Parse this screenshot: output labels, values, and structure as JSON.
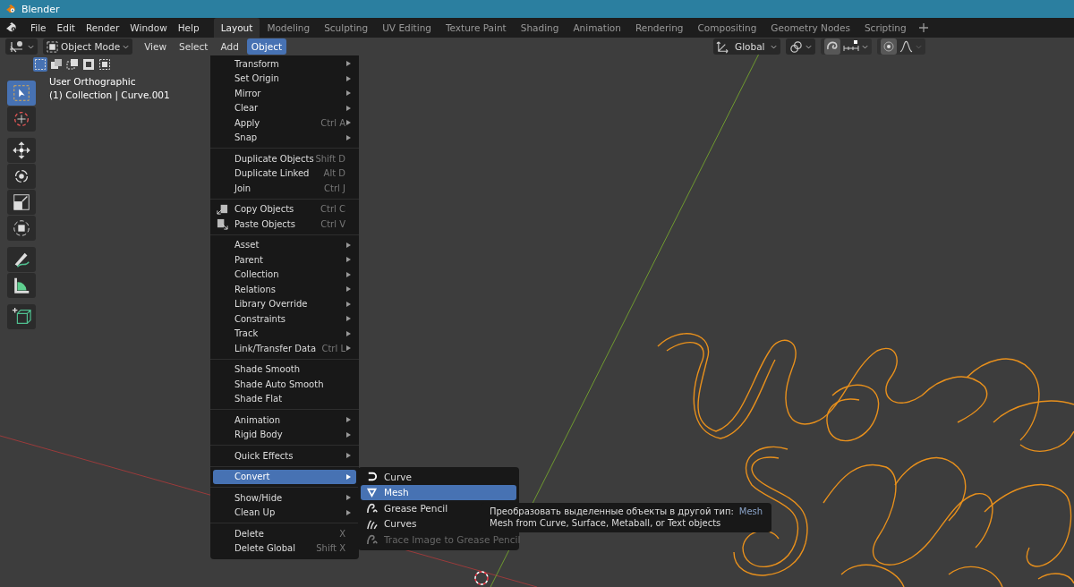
{
  "window": {
    "title": "Blender"
  },
  "menu_bar": [
    "File",
    "Edit",
    "Render",
    "Window",
    "Help"
  ],
  "workspaces": [
    {
      "label": "Layout",
      "selected": true
    },
    {
      "label": "Modeling",
      "selected": false
    },
    {
      "label": "Sculpting",
      "selected": false
    },
    {
      "label": "UV Editing",
      "selected": false
    },
    {
      "label": "Texture Paint",
      "selected": false
    },
    {
      "label": "Shading",
      "selected": false
    },
    {
      "label": "Animation",
      "selected": false
    },
    {
      "label": "Rendering",
      "selected": false
    },
    {
      "label": "Compositing",
      "selected": false
    },
    {
      "label": "Geometry Nodes",
      "selected": false
    },
    {
      "label": "Scripting",
      "selected": false
    }
  ],
  "header": {
    "mode": "Object Mode",
    "menus": [
      {
        "label": "View",
        "selected": false
      },
      {
        "label": "Select",
        "selected": false
      },
      {
        "label": "Add",
        "selected": false
      },
      {
        "label": "Object",
        "selected": true
      }
    ],
    "orientation": "Global"
  },
  "select_modes": [
    {
      "kind": "set",
      "selected": true
    },
    {
      "kind": "extend",
      "selected": false
    },
    {
      "kind": "subtract",
      "selected": false
    },
    {
      "kind": "difference",
      "selected": false
    },
    {
      "kind": "intersect",
      "selected": false
    }
  ],
  "tools": [
    {
      "kind": "select",
      "selected": true
    },
    {
      "kind": "cursor",
      "selected": false
    },
    {
      "kind": "move",
      "selected": false
    },
    {
      "kind": "rotate",
      "selected": false
    },
    {
      "kind": "scale",
      "selected": false
    },
    {
      "kind": "transform",
      "selected": false
    },
    {
      "kind": "annotate",
      "selected": false
    },
    {
      "kind": "measure",
      "selected": false
    },
    {
      "kind": "add_cube",
      "selected": false
    }
  ],
  "viewport": {
    "view": "User Orthographic",
    "context": "(1) Collection | Curve.001"
  },
  "object_menu": [
    [
      {
        "label": "Transform",
        "kind": "plain",
        "submenu": true,
        "selected": false
      },
      {
        "label": "Set Origin",
        "kind": "plain",
        "submenu": true,
        "selected": false
      },
      {
        "label": "Mirror",
        "kind": "plain",
        "submenu": true,
        "selected": false
      },
      {
        "label": "Clear",
        "kind": "plain",
        "submenu": true,
        "selected": false
      },
      {
        "label": "Apply",
        "kind": "plain",
        "shortcut": "Ctrl A",
        "submenu": true,
        "selected": false
      },
      {
        "label": "Snap",
        "kind": "plain",
        "submenu": true,
        "selected": false
      }
    ],
    [
      {
        "label": "Duplicate Objects",
        "kind": "plain",
        "shortcut": "Shift D",
        "submenu": false,
        "selected": false
      },
      {
        "label": "Duplicate Linked",
        "kind": "plain",
        "shortcut": "Alt D",
        "submenu": false,
        "selected": false
      },
      {
        "label": "Join",
        "kind": "plain",
        "shortcut": "Ctrl J",
        "submenu": false,
        "selected": false
      }
    ],
    [
      {
        "label": "Copy Objects",
        "kind": "copy",
        "shortcut": "Ctrl C",
        "submenu": false,
        "selected": false
      },
      {
        "label": "Paste Objects",
        "kind": "paste",
        "shortcut": "Ctrl V",
        "submenu": false,
        "selected": false
      }
    ],
    [
      {
        "label": "Asset",
        "kind": "plain",
        "submenu": true,
        "selected": false
      },
      {
        "label": "Parent",
        "kind": "plain",
        "submenu": true,
        "selected": false
      },
      {
        "label": "Collection",
        "kind": "plain",
        "submenu": true,
        "selected": false
      },
      {
        "label": "Relations",
        "kind": "plain",
        "submenu": true,
        "selected": false
      },
      {
        "label": "Library Override",
        "kind": "plain",
        "submenu": true,
        "selected": false
      },
      {
        "label": "Constraints",
        "kind": "plain",
        "submenu": true,
        "selected": false
      },
      {
        "label": "Track",
        "kind": "plain",
        "submenu": true,
        "selected": false
      },
      {
        "label": "Link/Transfer Data",
        "kind": "plain",
        "shortcut": "Ctrl L",
        "submenu": true,
        "selected": false
      }
    ],
    [
      {
        "label": "Shade Smooth",
        "kind": "plain",
        "submenu": false,
        "selected": false
      },
      {
        "label": "Shade Auto Smooth",
        "kind": "plain",
        "submenu": false,
        "selected": false
      },
      {
        "label": "Shade Flat",
        "kind": "plain",
        "submenu": false,
        "selected": false
      }
    ],
    [
      {
        "label": "Animation",
        "kind": "plain",
        "submenu": true,
        "selected": false
      },
      {
        "label": "Rigid Body",
        "kind": "plain",
        "submenu": true,
        "selected": false
      }
    ],
    [
      {
        "label": "Quick Effects",
        "kind": "plain",
        "submenu": true,
        "selected": false
      }
    ],
    [
      {
        "label": "Convert",
        "kind": "plain",
        "submenu": true,
        "selected": true
      }
    ],
    [
      {
        "label": "Show/Hide",
        "kind": "plain",
        "submenu": true,
        "selected": false
      },
      {
        "label": "Clean Up",
        "kind": "plain",
        "submenu": true,
        "selected": false
      }
    ],
    [
      {
        "label": "Delete",
        "kind": "plain",
        "shortcut": "X",
        "submenu": false,
        "selected": false
      },
      {
        "label": "Delete Global",
        "kind": "plain",
        "shortcut": "Shift X",
        "submenu": false,
        "selected": false
      }
    ]
  ],
  "convert_submenu": [
    {
      "label": "Curve",
      "kind": "curve",
      "selected": false,
      "disabled": false
    },
    {
      "label": "Mesh",
      "kind": "mesh",
      "selected": true,
      "disabled": false
    },
    {
      "label": "Grease Pencil",
      "kind": "grease_pencil",
      "selected": false,
      "disabled": false
    },
    {
      "label": "Curves",
      "kind": "curves",
      "selected": false,
      "disabled": false
    },
    {
      "label": "Trace Image to Grease Pencil",
      "kind": "trace",
      "selected": false,
      "disabled": true
    }
  ],
  "tooltip": {
    "text": "Преобразовать выделенные объекты в другой тип:",
    "value": "Mesh",
    "description": "Mesh from Curve, Surface, Metaball, or Text objects"
  }
}
